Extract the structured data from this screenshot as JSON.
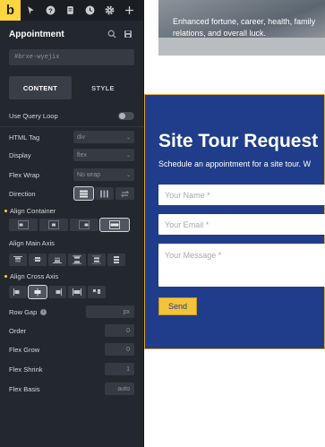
{
  "app": {
    "logo_letter": "b"
  },
  "panel": {
    "title": "Appointment",
    "element_id": "#brxe-wyejix",
    "tabs": [
      {
        "label": "CONTENT"
      },
      {
        "label": "STYLE"
      }
    ],
    "use_query_loop": {
      "label": "Use Query Loop",
      "on": false
    },
    "html_tag": {
      "label": "HTML Tag",
      "value": "div"
    },
    "display": {
      "label": "Display",
      "value": "flex"
    },
    "flex_wrap": {
      "label": "Flex Wrap",
      "value": "No wrap"
    },
    "direction": {
      "label": "Direction"
    },
    "align_container": {
      "label": "Align Container"
    },
    "align_main_axis": {
      "label": "Align Main Axis"
    },
    "align_cross_axis": {
      "label": "Align Cross Axis"
    },
    "row_gap": {
      "label": "Row Gap",
      "value": "",
      "unit": "px"
    },
    "order": {
      "label": "Order",
      "value": "0"
    },
    "flex_grow": {
      "label": "Flex Grow",
      "value": "0"
    },
    "flex_shrink": {
      "label": "Flex Shrink",
      "value": "1"
    },
    "flex_basis": {
      "label": "Flex Basis",
      "value": "auto"
    }
  },
  "canvas": {
    "hero_text": "Enhanced fortune, career, health, family relations, and overall luck.",
    "form": {
      "heading": "Site Tour Request",
      "subtitle": "Schedule an appointment for a site tour. W",
      "name_placeholder": "Your Name *",
      "email_placeholder": "Your Email *",
      "message_placeholder": "Your Message *",
      "send_label": "Send"
    }
  },
  "colors": {
    "accent": "#ffd53e",
    "form_bg": "#1f3d8a",
    "panel_bg": "#23272e"
  }
}
